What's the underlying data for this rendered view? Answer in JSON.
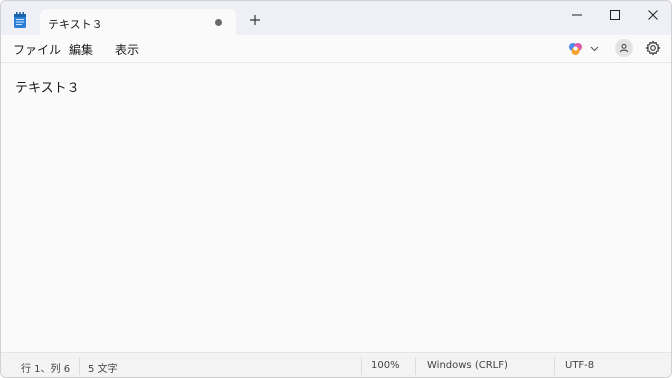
{
  "tab": {
    "title": "テキスト３"
  },
  "menu": {
    "file": "ファイル",
    "edit": "編集",
    "view": "表示"
  },
  "editor": {
    "content": "テキスト３"
  },
  "status": {
    "position": "行 1、列 6",
    "char_count": "5 文字",
    "zoom": "100%",
    "line_ending": "Windows (CRLF)",
    "encoding": "UTF-8"
  },
  "colors": {
    "titlebar_bg": "#eef0f6",
    "editor_bg": "#fafafa",
    "statusbar_bg": "#f3f3f3",
    "app_icon": "#2b7fd8"
  },
  "icons": {
    "app": "notepad-icon",
    "unsaved": "unsaved-dot-icon",
    "new_tab": "plus-icon",
    "minimize": "minimize-icon",
    "maximize": "maximize-icon",
    "close": "close-icon",
    "copilot": "copilot-icon",
    "profile": "profile-icon",
    "settings": "gear-icon"
  }
}
